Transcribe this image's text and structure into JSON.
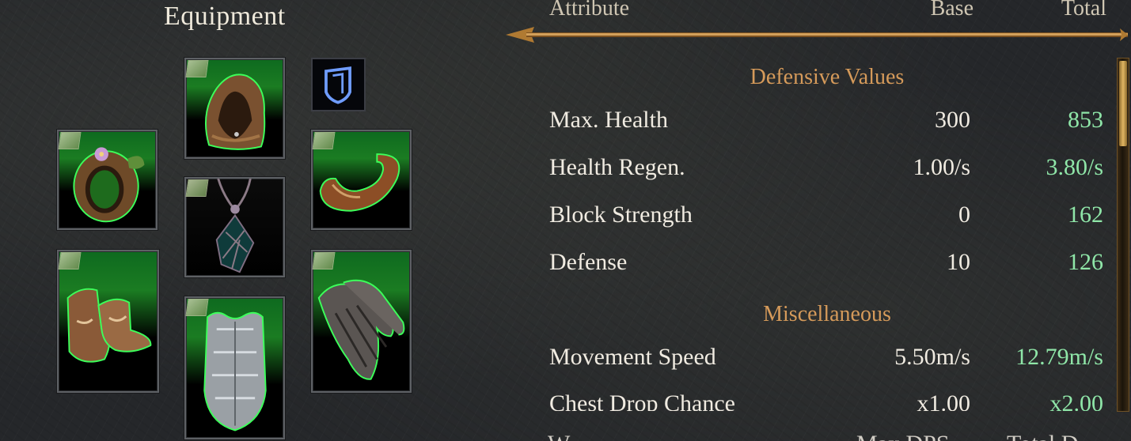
{
  "equipment": {
    "title": "Equipment",
    "slots": [
      {
        "name": "Hood"
      },
      {
        "name": "Ring"
      },
      {
        "name": "Amulet"
      },
      {
        "name": "Bracelet"
      },
      {
        "name": "Boots"
      },
      {
        "name": "Chest Armor"
      },
      {
        "name": "Gloves"
      }
    ],
    "shield_icon": "shield-icon"
  },
  "stats": {
    "headers": {
      "attribute": "Attribute",
      "base": "Base",
      "total": "Total"
    },
    "sections": [
      {
        "title": "Defensive Values",
        "rows": [
          {
            "label": "Max. Health",
            "base": "300",
            "total": "853"
          },
          {
            "label": "Health Regen.",
            "base": "1.00/s",
            "total": "3.80/s"
          },
          {
            "label": "Block Strength",
            "base": "0",
            "total": "162"
          },
          {
            "label": "Defense",
            "base": "10",
            "total": "126"
          }
        ]
      },
      {
        "title": "Miscellaneous",
        "rows": [
          {
            "label": "Movement Speed",
            "base": "5.50m/s",
            "total": "12.79m/s"
          },
          {
            "label": "Chest Drop Chance",
            "base": "x1.00",
            "total": "x2.00"
          }
        ]
      }
    ],
    "next_row": {
      "label": "W",
      "base": "Max DPS",
      "total": "Total D"
    }
  },
  "colors": {
    "total_value": "#8fe6a8",
    "section_title": "#d59a5a",
    "item_bg": "#1b7c22",
    "divider_gold": "#b07a32"
  }
}
